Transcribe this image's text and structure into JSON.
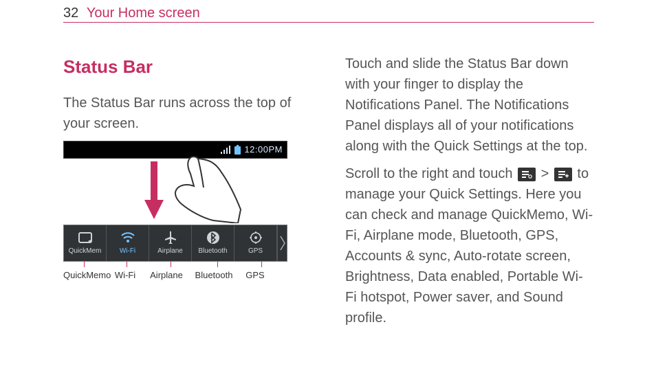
{
  "header": {
    "page_number": "32",
    "breadcrumb": "Your Home screen"
  },
  "left": {
    "title": "Status Bar",
    "intro": "The Status Bar runs across the top of your screen.",
    "statusbar": {
      "time": "12:00PM"
    },
    "quick_items": [
      {
        "short": "QuickMem",
        "label": "QuickMemo"
      },
      {
        "short": "Wi-Fi",
        "label": "Wi-Fi"
      },
      {
        "short": "Airplane",
        "label": "Airplane"
      },
      {
        "short": "Bluetooth",
        "label": "Bluetooth"
      },
      {
        "short": "GPS",
        "label": "GPS"
      }
    ]
  },
  "right": {
    "para1": "Touch and slide the Status Bar down with your finger to display the Notifications Panel. The Notifications Panel displays all of your notifications along with the Quick Settings at the top.",
    "para2a": "Scroll to the right and touch ",
    "para2b": " > ",
    "para2c": " to manage your Quick Settings. Here you can check and manage QuickMemo, Wi-Fi, Airplane mode, Bluetooth, GPS, Accounts & sync, Auto-rotate screen, Brightness, Data enabled, Portable Wi-Fi hotspot, Power saver, and Sound profile."
  }
}
